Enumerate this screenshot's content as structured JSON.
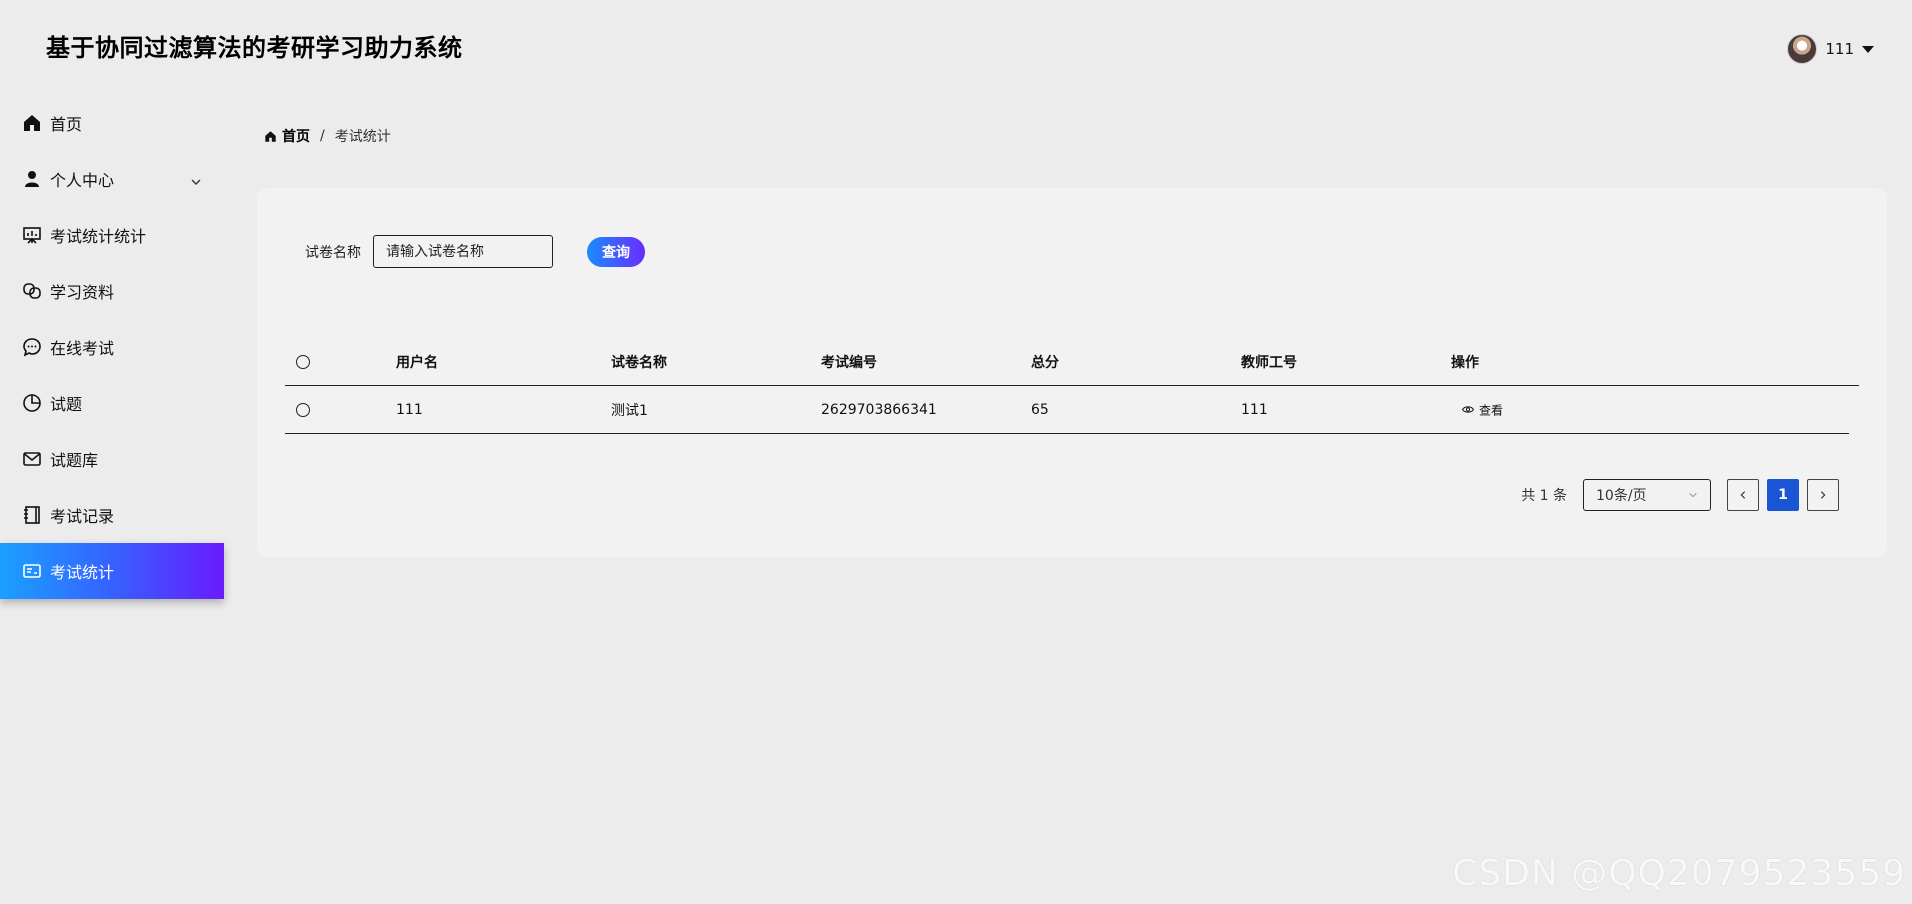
{
  "header": {
    "title": "基于协同过滤算法的考研学习助力系统",
    "user_name": "111"
  },
  "sidebar": {
    "items": [
      {
        "label": "首页",
        "icon": "home-icon"
      },
      {
        "label": "个人中心",
        "icon": "user-icon"
      },
      {
        "label": "考试统计统计",
        "icon": "presentation-icon"
      },
      {
        "label": "学习资料",
        "icon": "link-icon"
      },
      {
        "label": "在线考试",
        "icon": "chat-icon"
      },
      {
        "label": "试题",
        "icon": "pie-chart-icon"
      },
      {
        "label": "试题库",
        "icon": "mail-icon"
      },
      {
        "label": "考试记录",
        "icon": "notebook-icon"
      },
      {
        "label": "考试统计",
        "icon": "id-card-icon"
      }
    ],
    "active_index": 8
  },
  "breadcrumb": {
    "home": "首页",
    "separator": "/",
    "current": "考试统计"
  },
  "search": {
    "label": "试卷名称",
    "placeholder": "请输入试卷名称",
    "button": "查询"
  },
  "table": {
    "columns": [
      "用户名",
      "试卷名称",
      "考试编号",
      "总分",
      "教师工号",
      "操作"
    ],
    "rows": [
      {
        "username": "111",
        "paper": "测试1",
        "exam_no": "2629703866341",
        "score": "65",
        "teacher_no": "111",
        "action": "查看"
      }
    ]
  },
  "pagination": {
    "total": "共 1 条",
    "page_size": "10条/页",
    "current_page": "1"
  },
  "watermark": "CSDN @QQ2079523559",
  "colors": {
    "accent_start": "#1aa0ff",
    "accent_end": "#6a1bff",
    "page_active": "#1a55d6"
  }
}
